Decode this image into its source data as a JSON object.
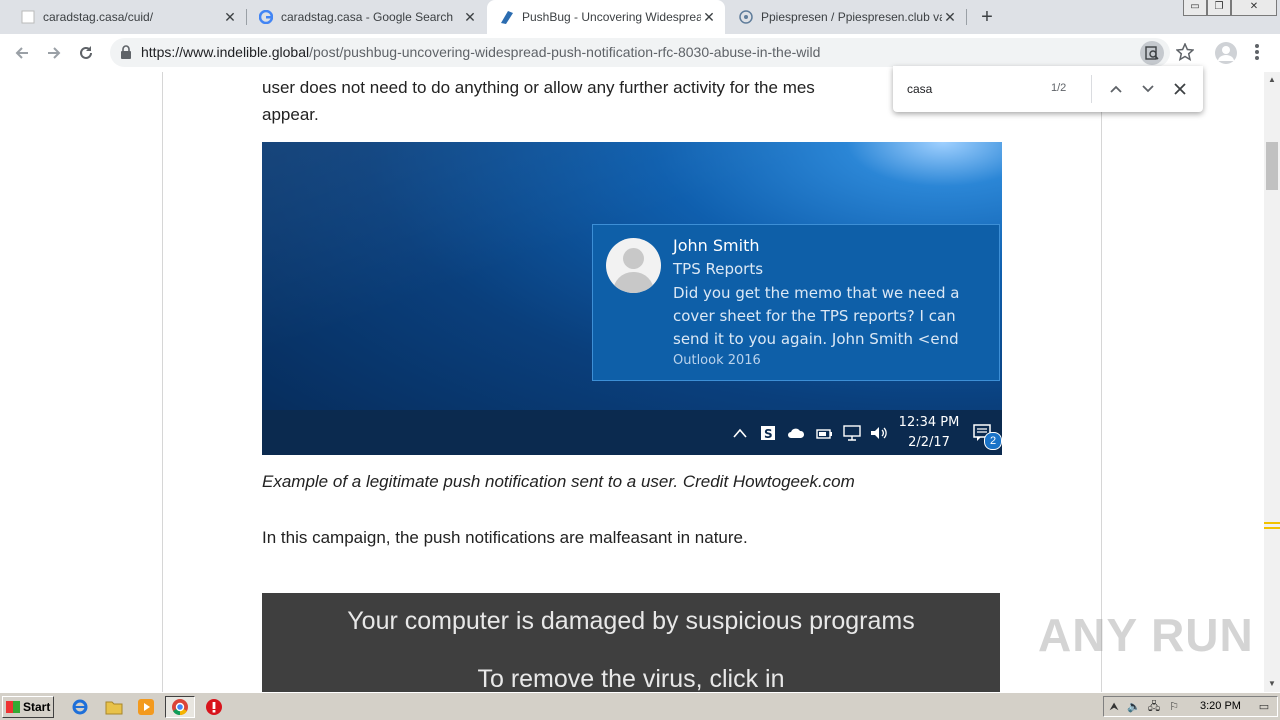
{
  "browser": {
    "tabs": [
      {
        "title": "caradstag.casa/cuid/",
        "favicon": "blank-page-icon"
      },
      {
        "title": "caradstag.casa - Google Search",
        "favicon": "google-icon"
      },
      {
        "title": "PushBug - Uncovering Widespread P",
        "favicon": "indelible-icon",
        "active": true
      },
      {
        "title": "Ppiespresen / Ppiespresen.club valu",
        "favicon": "anyrun-icon"
      }
    ],
    "url_host": "https://www.indelible.global",
    "url_path": "/post/pushbug-uncovering-widespread-push-notification-rfc-8030-abuse-in-the-wild",
    "window_controls": {
      "minimize": "▭",
      "restore": "❐",
      "close": "✕"
    }
  },
  "find_bar": {
    "query": "casa",
    "count": "1/2"
  },
  "article": {
    "para_top_line1": "user does not need to do anything or allow any further activity for the mes",
    "para_top_line2": "appear.",
    "caption": "Example of a legitimate push notification sent to a user. Credit Howtogeek.com",
    "para_campaign": "In this campaign, the push notifications are malfeasant in nature."
  },
  "notification_image": {
    "sender": "John Smith",
    "subject": "TPS Reports",
    "message_lines": [
      "Did you get the memo that we need a",
      "cover sheet for the TPS reports? I can",
      "send it to you again.  John Smith <end"
    ],
    "app": "Outlook 2016",
    "time": "12:34 PM",
    "date": "2/2/17",
    "action_badge": "2"
  },
  "scam_image": {
    "line1": "Your computer is damaged by suspicious programs",
    "line2": "To remove the virus, click in"
  },
  "watermark": "ANY RUN",
  "os_taskbar": {
    "start_label": "Start",
    "clock": "3:20 PM"
  }
}
